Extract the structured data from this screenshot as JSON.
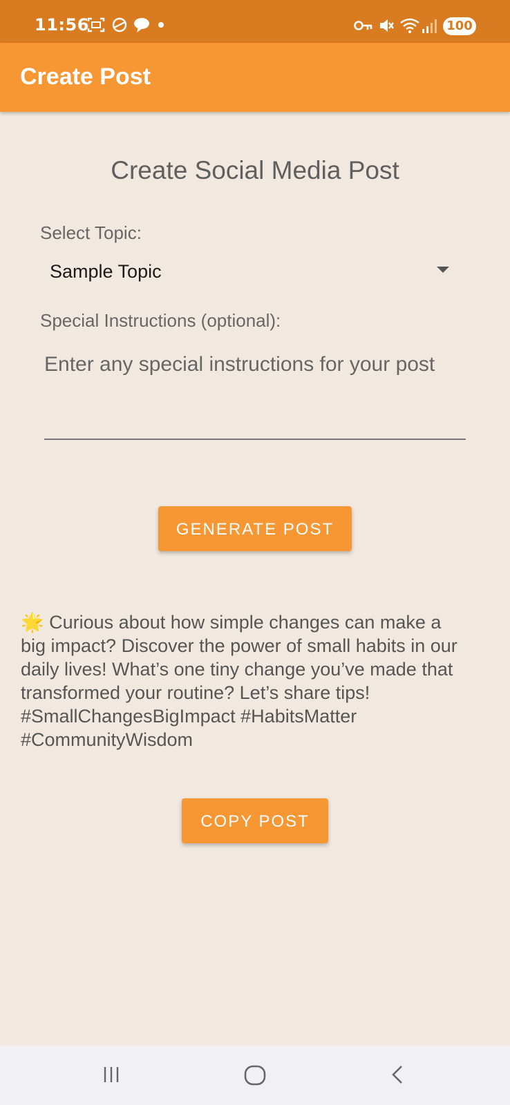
{
  "status_bar": {
    "time": "11:56",
    "battery": "100",
    "left_icons": [
      "screenshot-icon",
      "vpn-globe-icon",
      "chat-bubble-icon",
      "notification-dot-icon"
    ],
    "right_icons": [
      "vpn-key-icon",
      "mute-icon",
      "wifi-icon",
      "signal-icon"
    ]
  },
  "app_bar": {
    "title": "Create Post"
  },
  "form": {
    "heading": "Create Social Media Post",
    "topic_label": "Select Topic:",
    "topic_value": "Sample Topic",
    "instructions_label": "Special Instructions (optional):",
    "instructions_placeholder": "Enter any special instructions for your post",
    "generate_label": "GENERATE POST"
  },
  "post": {
    "emoji": "🌟",
    "text": " Curious about how simple changes can make a big impact? Discover the power of small habits in our daily lives! What’s one tiny change you’ve made that transformed your routine? Let’s share tips! #SmallChangesBigImpact #HabitsMatter #CommunityWisdom",
    "copy_label": "COPY POST"
  },
  "nav_bar": {
    "items": [
      "recent-apps-icon",
      "home-icon",
      "back-icon"
    ]
  },
  "colors": {
    "status_bar": "#d97c21",
    "accent": "#f69733",
    "background": "#f1e9df"
  }
}
